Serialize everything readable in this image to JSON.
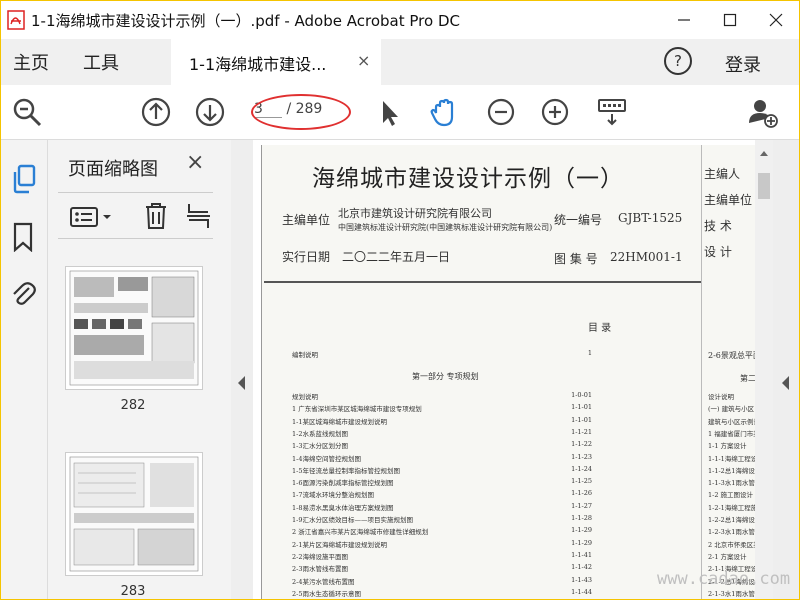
{
  "window": {
    "title": "1-1海绵城市建设设计示例（一）.pdf - Adobe Acrobat Pro DC"
  },
  "menu": {
    "home": "主页",
    "tools": "工具",
    "doc_tab": "1-1海绵城市建设...",
    "doc_tab_close": "×",
    "help": "?",
    "login": "登录"
  },
  "toolbar": {
    "current_page": "3",
    "total_pages": "/ 289"
  },
  "thumbnails": {
    "title": "页面缩略图",
    "close": "×",
    "pages": [
      {
        "label": "282"
      },
      {
        "label": "283"
      }
    ]
  },
  "document": {
    "title": "海绵城市建设设计示例（一）",
    "unit_label": "主编单位",
    "unit_line1": "北京市建筑设计研究院有限公司",
    "unit_line2": "中国建筑标准设计研究院(中国建筑标准设计研究院有限公司)",
    "code_label": "统一编号",
    "code_value": "GJBT-1525",
    "date_label": "实行日期",
    "date_value": "二〇二二年五月一日",
    "atlas_label": "图 集 号",
    "atlas_value": "22HM001-1",
    "side_editors": [
      "主编人",
      "主编单位",
      "技  术",
      "设  计"
    ],
    "toc_title": "目      录",
    "toc_right_first": "2-6景观总平面图",
    "toc_intro": "编制说明",
    "toc_intro_page": "1",
    "part_title": "第一部分  专项规划",
    "part_right": "第二",
    "toc_items": [
      {
        "text": "规划说明",
        "page": "1-0-01"
      },
      {
        "text": "1 广东省深圳市某区城海绵城市建设专项规划",
        "page": "1-1-01"
      },
      {
        "text": "1-1某区城海绵城市建设规划说明",
        "page": "1-1-01"
      },
      {
        "text": "1-2水系蓝线规划图",
        "page": "1-1-21"
      },
      {
        "text": "1-3汇水分区划分图",
        "page": "1-1-22"
      },
      {
        "text": "1-4海绵空间管控规划图",
        "page": "1-1-23"
      },
      {
        "text": "1-5年径流总量控制率指标管控规划图",
        "page": "1-1-24"
      },
      {
        "text": "1-6面源污染削减率指标管控规划图",
        "page": "1-1-25"
      },
      {
        "text": "1-7流域水环境分整治规划图",
        "page": "1-1-26"
      },
      {
        "text": "1-8易涝水黑臭水体治理方案规划图",
        "page": "1-1-27"
      },
      {
        "text": "1-9汇水分区绩效目标——项目实施规划图",
        "page": "1-1-28"
      },
      {
        "text": "2 浙江省嘉兴市某片区海绵城市修建性详细规划",
        "page": "1-1-29"
      },
      {
        "text": "2-1某片区海绵城市建设规划说明",
        "page": "1-1-29"
      },
      {
        "text": "2-2海绵设施平面图",
        "page": "1-1-41"
      },
      {
        "text": "2-3雨水管线布置图",
        "page": "1-1-42"
      },
      {
        "text": "2-4某污水管线布置图",
        "page": "1-1-43"
      },
      {
        "text": "2-5雨水生态循环示意图",
        "page": "1-1-44"
      }
    ],
    "toc_right_items": [
      "设计说明",
      "(一) 建筑与小区",
      "建筑与小区示例说明",
      "1 福建省厦门市某新建住宅小区海绵",
      "1-1 方案设计",
      "1-1-1海绵工程设计说明",
      "1-1-2总1海绵设施平面图",
      "1-1-3水1雨水管线平面图",
      "1-2 施工图设计",
      "1-2-1海绵工程施工图说明",
      "1-2-2总1海绵设施平面图",
      "1-2-3水1雨水管线平面图",
      "2 北京市怀柔区某新建科研、办公楼",
      "2-1 方案设计",
      "2-1-1海绵工程设计说明",
      "2-1-2总1海绵设施平面",
      "2-1-3水1雨水管线平面"
    ]
  },
  "watermark": "www.cadao.com"
}
